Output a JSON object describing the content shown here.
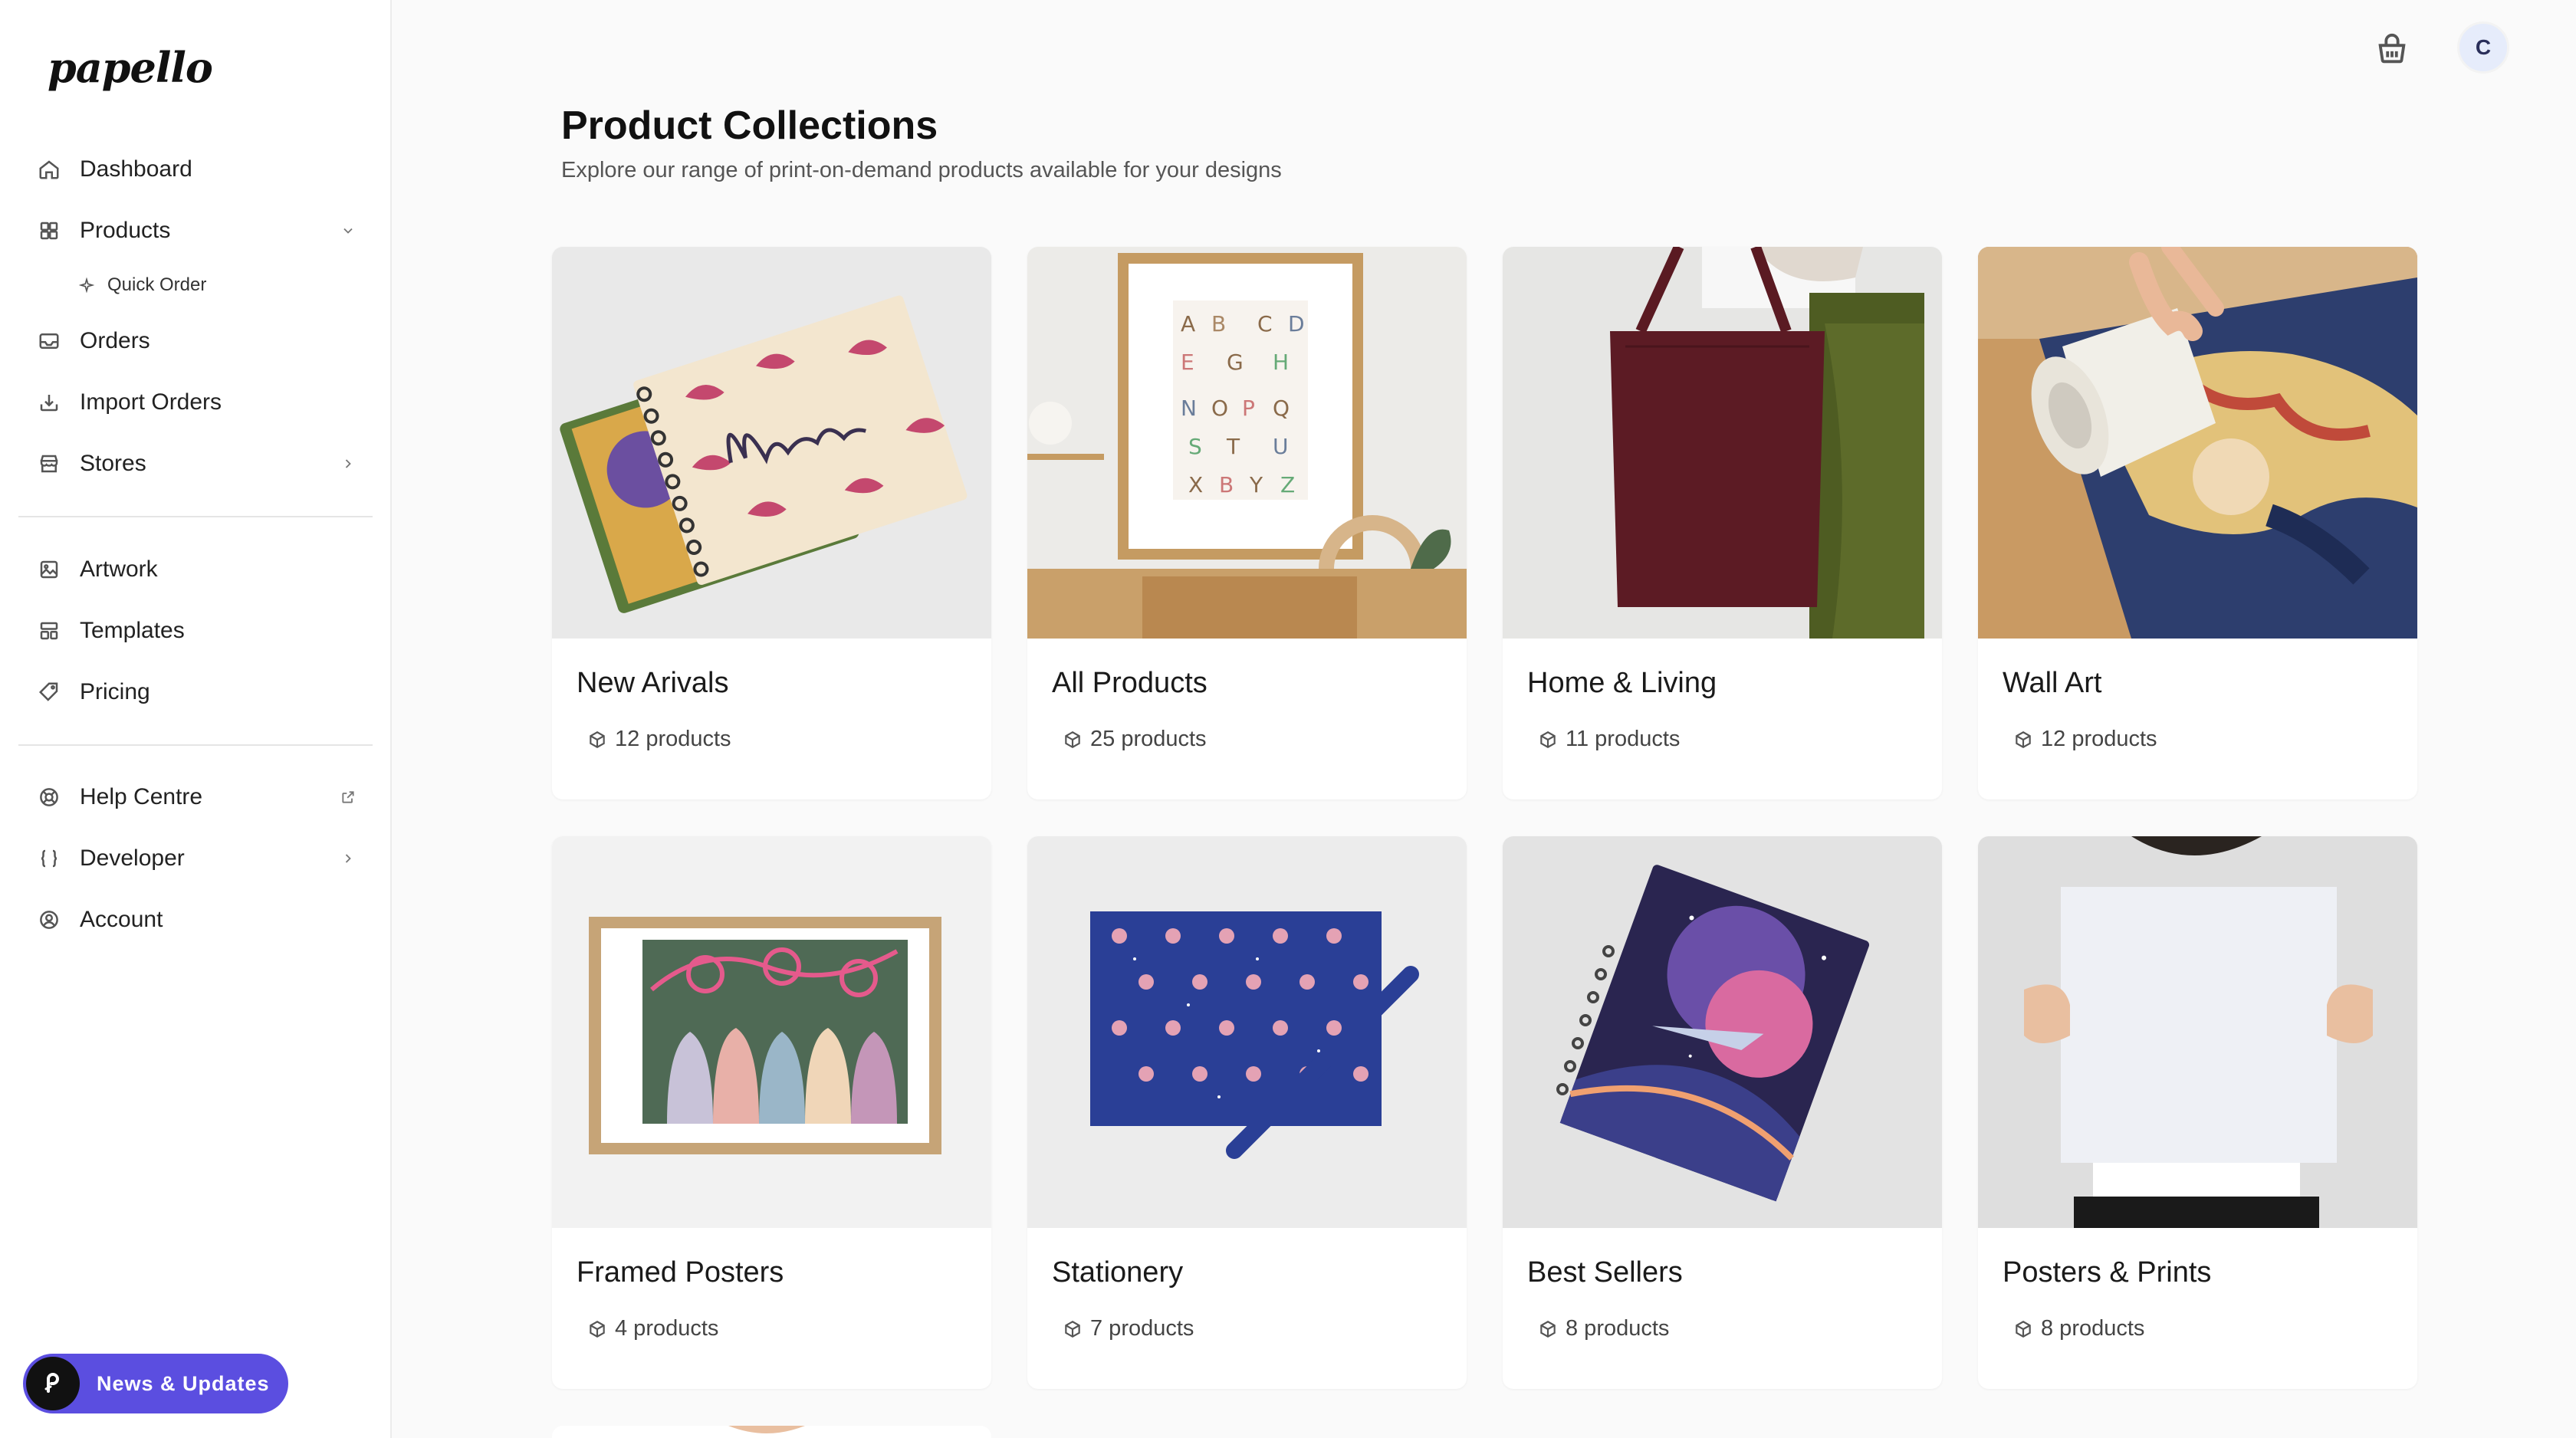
{
  "brand": {
    "logo_text": "papello"
  },
  "sidebar": {
    "items": [
      {
        "label": "Dashboard",
        "icon": "home-icon"
      },
      {
        "label": "Products",
        "icon": "grid-icon",
        "expanded": true
      },
      {
        "label": "Quick Order",
        "icon": "sparkle-icon"
      },
      {
        "label": "Orders",
        "icon": "inbox-icon"
      },
      {
        "label": "Import Orders",
        "icon": "import-icon"
      },
      {
        "label": "Stores",
        "icon": "store-icon"
      },
      {
        "label": "Artwork",
        "icon": "image-icon"
      },
      {
        "label": "Templates",
        "icon": "layout-icon"
      },
      {
        "label": "Pricing",
        "icon": "tag-icon"
      },
      {
        "label": "Help Centre",
        "icon": "lifebuoy-icon"
      },
      {
        "label": "Developer",
        "icon": "braces-icon"
      },
      {
        "label": "Account",
        "icon": "user-circle-icon"
      }
    ],
    "news_button": "News & Updates"
  },
  "header": {
    "avatar_initial": "C"
  },
  "main": {
    "title": "Product Collections",
    "subtitle": "Explore our range of print-on-demand products available for your designs",
    "collections": [
      {
        "name": "New Arivals",
        "count": "12 products"
      },
      {
        "name": "All Products",
        "count": "25 products"
      },
      {
        "name": "Home & Living",
        "count": "11 products"
      },
      {
        "name": "Wall Art",
        "count": "12 products"
      },
      {
        "name": "Framed Posters",
        "count": "4 products"
      },
      {
        "name": "Stationery",
        "count": "7 products"
      },
      {
        "name": "Best Sellers",
        "count": "8 products"
      },
      {
        "name": "Posters & Prints",
        "count": "8 products"
      }
    ]
  },
  "colors": {
    "accent": "#5b4ee0",
    "avatar_bg": "#e6ecfb"
  }
}
